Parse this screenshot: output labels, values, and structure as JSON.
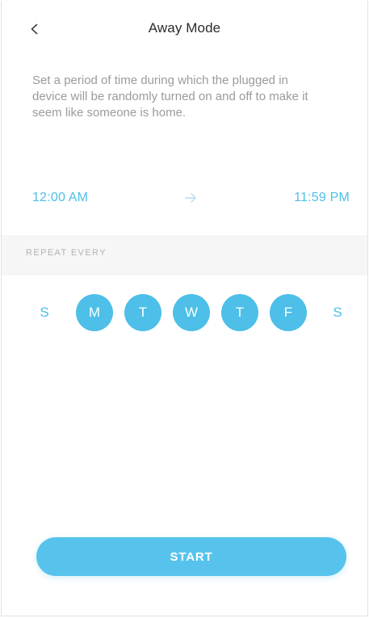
{
  "header": {
    "title": "Away Mode",
    "back_icon": "chevron-left-icon"
  },
  "description": "Set a period of time during which the plugged in device will be randomly turned on and off to make it seem like someone is home.",
  "schedule": {
    "start_time": "12:00 AM",
    "end_time": "11:59 PM",
    "separator_icon": "arrow-right-icon"
  },
  "repeat": {
    "label": "REPEAT EVERY",
    "days": [
      {
        "label": "S",
        "selected": false
      },
      {
        "label": "M",
        "selected": true
      },
      {
        "label": "T",
        "selected": true
      },
      {
        "label": "W",
        "selected": true
      },
      {
        "label": "T",
        "selected": true
      },
      {
        "label": "F",
        "selected": true
      },
      {
        "label": "S",
        "selected": false
      }
    ]
  },
  "actions": {
    "start_label": "START"
  },
  "colors": {
    "accent": "#4dbfe8",
    "button": "#57c3ec",
    "muted_text": "#9b9b9b",
    "section_bg": "#f6f6f6"
  }
}
